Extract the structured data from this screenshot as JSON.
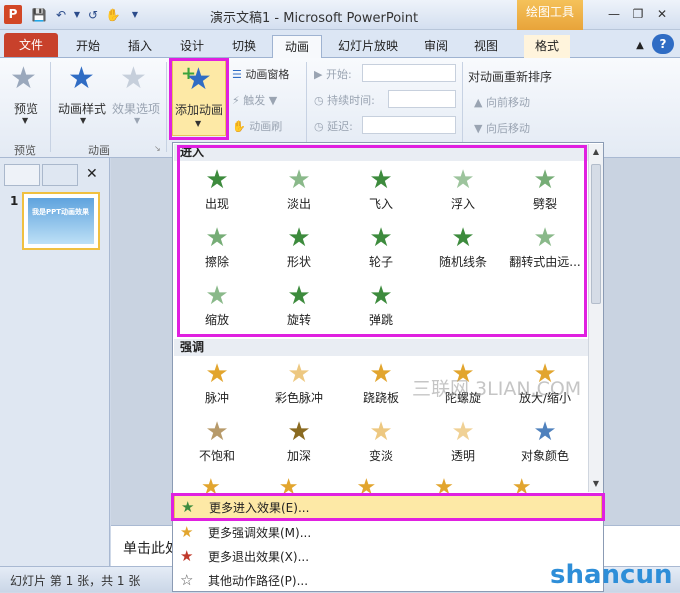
{
  "titlebar": {
    "title": "演示文稿1 - Microsoft PowerPoint",
    "app_icon": "P",
    "contextual_tab_group": "绘图工具"
  },
  "tabs": [
    "文件",
    "开始",
    "插入",
    "设计",
    "切换",
    "动画",
    "幻灯片放映",
    "审阅",
    "视图",
    "格式"
  ],
  "active_tab": "动画",
  "ribbon": {
    "preview_label": "预览",
    "preview_group": "预览",
    "animation_styles_label": "动画样式",
    "effect_options_label": "效果选项",
    "animation_group": "动画",
    "add_animation_label": "添加动画",
    "animation_pane_label": "动画窗格",
    "trigger_label": "触发",
    "animation_painter_label": "动画刷",
    "start_label": "开始:",
    "duration_label": "持续时间:",
    "delay_label": "延迟:",
    "reorder_title": "对动画重新排序",
    "move_earlier_label": "向前移动",
    "move_later_label": "向后移动"
  },
  "left_pane": {
    "slide_number": "1",
    "thumb_text": "我是PPT动画效果"
  },
  "notes_placeholder": "单击此处",
  "status_bar": "幻灯片 第 1 张，共 1 张",
  "dropdown": {
    "entrance_header": "进入",
    "entrance_effects": [
      "出现",
      "淡出",
      "飞入",
      "浮入",
      "劈裂",
      "擦除",
      "形状",
      "轮子",
      "随机线条",
      "翻转式由远...",
      "缩放",
      "旋转",
      "弹跳"
    ],
    "emphasis_header": "强调",
    "emphasis_effects": [
      "脉冲",
      "彩色脉冲",
      "跷跷板",
      "陀螺旋",
      "放大/缩小",
      "不饱和",
      "加深",
      "变淡",
      "透明",
      "对象颜色"
    ],
    "menu": [
      {
        "label": "更多进入效果(E)...",
        "icon": "green-star-icon"
      },
      {
        "label": "更多强调效果(M)...",
        "icon": "yellow-star-icon"
      },
      {
        "label": "更多退出效果(X)...",
        "icon": "red-star-icon"
      },
      {
        "label": "其他动作路径(P)...",
        "icon": "outline-star-icon"
      }
    ]
  },
  "watermarks": [
    "三联网 3LIAN.COM",
    "shancun"
  ],
  "colors": {
    "highlight": "#e020e0",
    "file_tab": "#c8412b",
    "drawing_tools": "#e8a43a",
    "entrance_star": "#3d8b3d",
    "emphasis_star": "#e2a52e"
  }
}
